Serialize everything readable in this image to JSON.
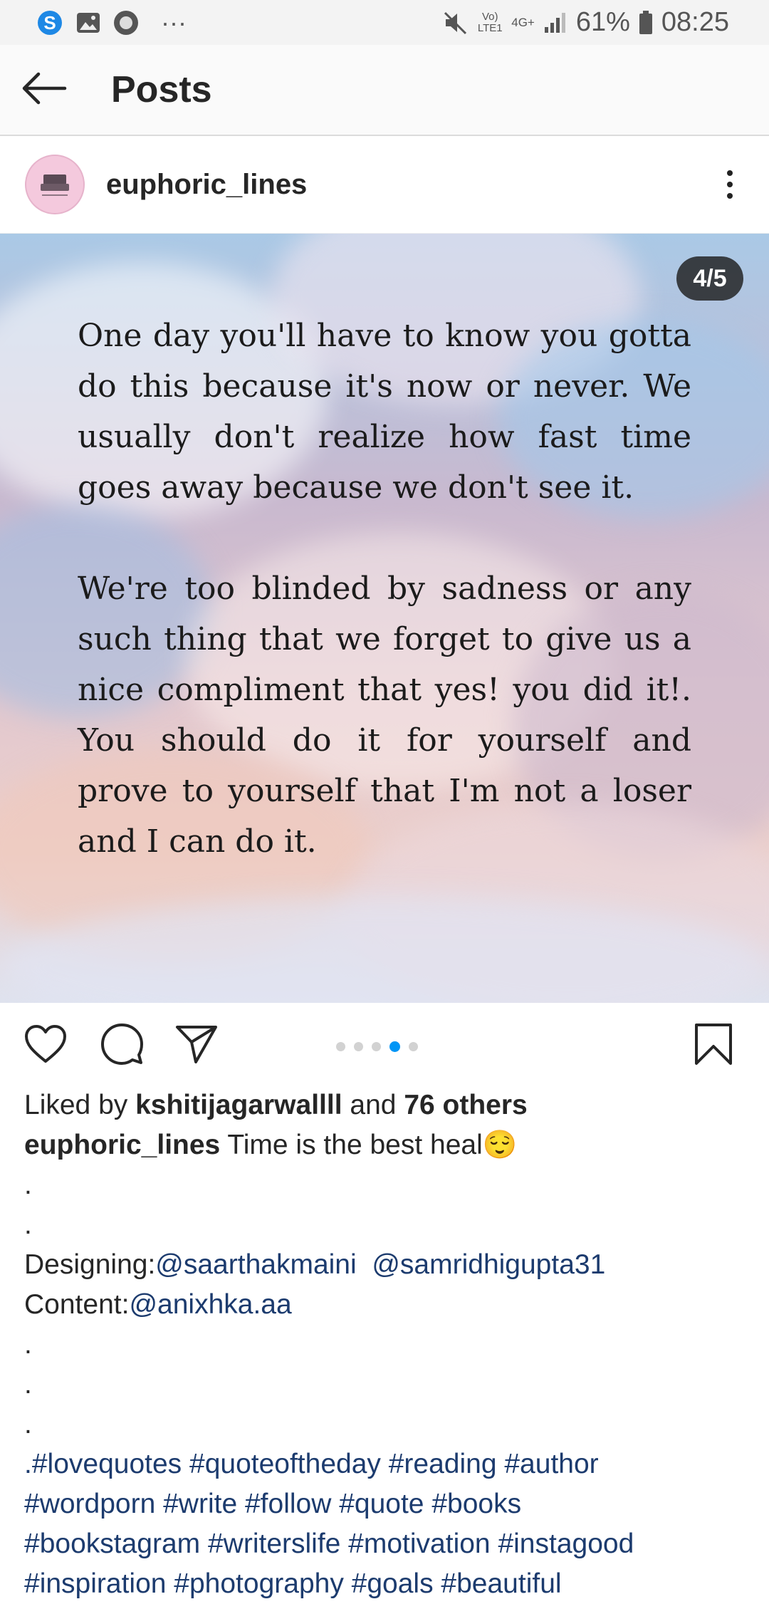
{
  "status_bar": {
    "battery": "61%",
    "time": "08:25",
    "network": "4G+",
    "volte": "Vo) LTE1",
    "more": "···"
  },
  "header": {
    "title": "Posts"
  },
  "post": {
    "username": "euphoric_lines",
    "counter": "4/5",
    "quote_p1": "One day you'll have to know you gotta do this because it's now or never. We usually don't realize how fast time goes away because we don't see it.",
    "quote_p2": "We're too blinded by sadness or any such thing that we forget to give us a nice compliment that yes! you did it!. You should do it for yourself and prove to yourself that I'm not a loser and I can do it.",
    "carousel": {
      "count": 5,
      "active": 4
    }
  },
  "likes": {
    "prefix": "Liked by ",
    "user": "kshitijagarwallll",
    "middle": " and ",
    "others": "76 others"
  },
  "caption": {
    "username": "euphoric_lines",
    "text": " Time is the best heal😌",
    "dot": ".",
    "designing_label": "Designing:",
    "designer1": "@saarthakmaini",
    "designer2": "@samridhigupta31",
    "content_label": "Content:",
    "content_author": "@anixhka.aa",
    "hashtags_line1": ".#lovequotes #quoteoftheday #reading #author",
    "hashtags_line2": "#wordporn #write #follow #quote #books",
    "hashtags_line3": "#bookstagram #writerslife #motivation #instagood",
    "hashtags_line4": "#inspiration #photography #goals #beautiful"
  },
  "colors": {
    "link": "#1c3b6e",
    "carousel_active": "#0095f6"
  },
  "icons": [
    "skype-icon",
    "gallery-icon",
    "record-icon",
    "mute-icon",
    "signal-icon",
    "battery-icon",
    "back-arrow-icon",
    "more-vertical-icon",
    "heart-icon",
    "comment-icon",
    "share-icon",
    "bookmark-icon"
  ]
}
